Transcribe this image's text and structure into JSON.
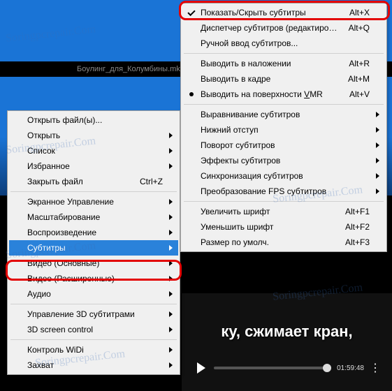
{
  "title": "Боулинг_для_Колумбины.mkv",
  "subtitle_overlay": "ку, сжимает кран,",
  "timecode": "01:59:48",
  "left_menu": {
    "g1": [
      {
        "label": "Открыть файл(ы)...",
        "sub": false
      },
      {
        "label": "Открыть",
        "sub": true
      },
      {
        "label": "Список",
        "sub": true
      },
      {
        "label": "Избранное",
        "sub": true
      },
      {
        "label": "Закрыть файл",
        "sub": false,
        "accel": "Ctrl+Z"
      }
    ],
    "g2": [
      {
        "label": "Экранное Управление",
        "sub": true
      },
      {
        "label": "Масштабирование",
        "sub": true
      },
      {
        "label": "Воспроизведение",
        "sub": true
      },
      {
        "label": "Субтитры",
        "sub": true,
        "hover": true
      },
      {
        "label": "Видео (Основные)",
        "sub": true
      },
      {
        "label": "Видео (Расширенные)",
        "sub": true
      },
      {
        "label": "Аудио",
        "sub": true
      }
    ],
    "g3": [
      {
        "label": "Управление 3D субтитрами",
        "sub": true
      },
      {
        "label": "3D screen control",
        "sub": true
      }
    ],
    "g4": [
      {
        "label": "Контроль WiDi",
        "sub": true
      },
      {
        "label": "Захват",
        "sub": true
      }
    ]
  },
  "right_menu": {
    "g1": [
      {
        "label": "Показать/Скрыть субтитры",
        "accel": "Alt+X",
        "check": true
      },
      {
        "label": "Диспетчер субтитров (редактирование)...",
        "accel": "Alt+Q"
      },
      {
        "label": "Ручной ввод субтитров..."
      }
    ],
    "g2": [
      {
        "label": "Выводить в наложении",
        "accel": "Alt+R"
      },
      {
        "label": "Выводить в кадре",
        "accel": "Alt+M"
      },
      {
        "label": "Выводить на поверхности VMR",
        "accel": "Alt+V",
        "radio": true,
        "uline": "V"
      }
    ],
    "g3": [
      {
        "label": "Выравнивание субтитров",
        "sub": true
      },
      {
        "label": "Нижний отступ",
        "sub": true
      },
      {
        "label": "Поворот субтитров",
        "sub": true
      },
      {
        "label": "Эффекты субтитров",
        "sub": true
      },
      {
        "label": "Синхронизация субтитров",
        "sub": true
      },
      {
        "label": "Преобразование FPS субтитров",
        "sub": true
      }
    ],
    "g4": [
      {
        "label": "Увеличить шрифт",
        "accel": "Alt+F1"
      },
      {
        "label": "Уменьшить шрифт",
        "accel": "Alt+F2"
      },
      {
        "label": "Размер по умолч.",
        "accel": "Alt+F3"
      }
    ]
  },
  "watermarks": [
    "Soringpcrepair.Com",
    "Soringpcrepair.Com",
    "Soringpcrepair.Com",
    "Soringpcrepair.Com",
    "Soringpcrepair.Com",
    "Soringpcrepair.Com"
  ]
}
